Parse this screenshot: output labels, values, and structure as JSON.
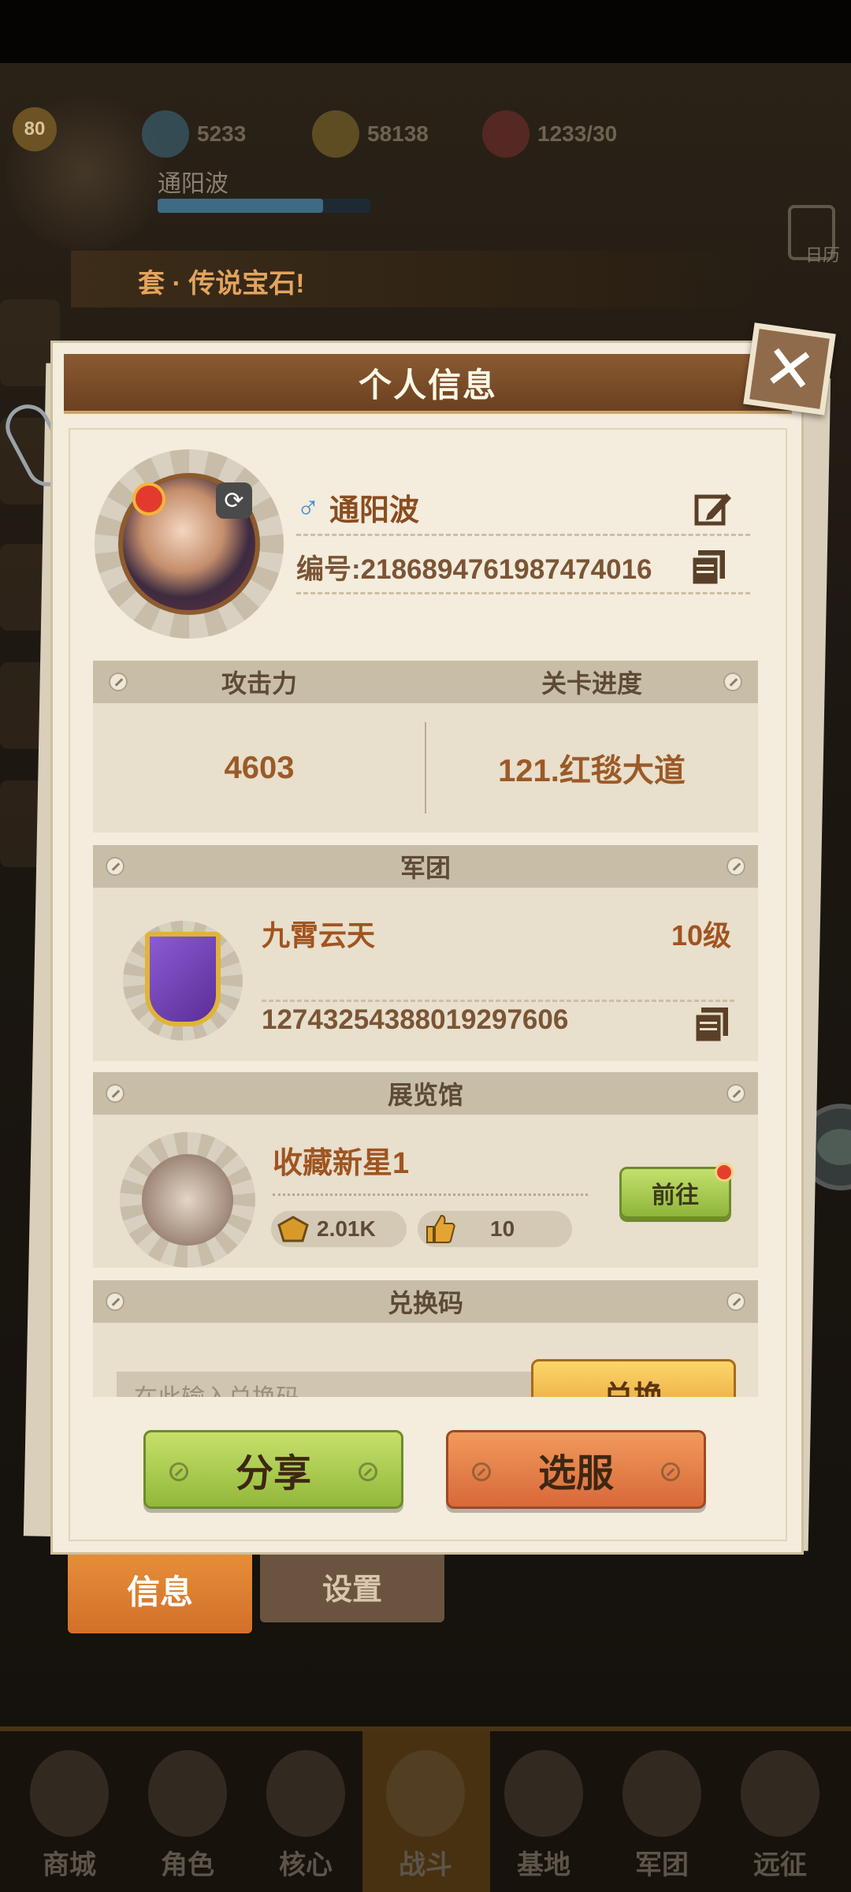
{
  "hud": {
    "level": "80",
    "gems": "5233",
    "coins": "58138",
    "stamina": "1233/30",
    "player_name": "通阳波",
    "calendar_label": "日历",
    "banner_text": "套 · 传说宝石!"
  },
  "popup": {
    "title": "个人信息",
    "player": {
      "gender_symbol": "♂",
      "name": "通阳波",
      "id_text": "编号:2186894761987474016"
    },
    "stats": {
      "attack_label": "攻击力",
      "progress_label": "关卡进度",
      "attack_value": "4603",
      "progress_value": "121.红毯大道"
    },
    "legion": {
      "section_title": "军团",
      "name": "九霄云天",
      "level": "10级",
      "id": "1274325438801929760​6"
    },
    "museum": {
      "section_title": "展览馆",
      "name": "收藏新星1",
      "score": "2.01K",
      "likes": "10",
      "go_label": "前往"
    },
    "redeem": {
      "section_title": "兑换码",
      "placeholder": "在此输入兑换码",
      "button_label": "兑换"
    },
    "actions": {
      "share_label": "分享",
      "server_label": "选服"
    }
  },
  "tabs": {
    "info_label": "信息",
    "settings_label": "设置"
  },
  "bottom_nav": [
    "商城",
    "角色",
    "核心",
    "战斗",
    "基地",
    "军团",
    "远征"
  ],
  "colors": {
    "panel_bg": "#f4ecdc",
    "title_bar": "#7a4c28",
    "accent_orange": "#e8913a",
    "accent_green": "#a8cc4f"
  }
}
